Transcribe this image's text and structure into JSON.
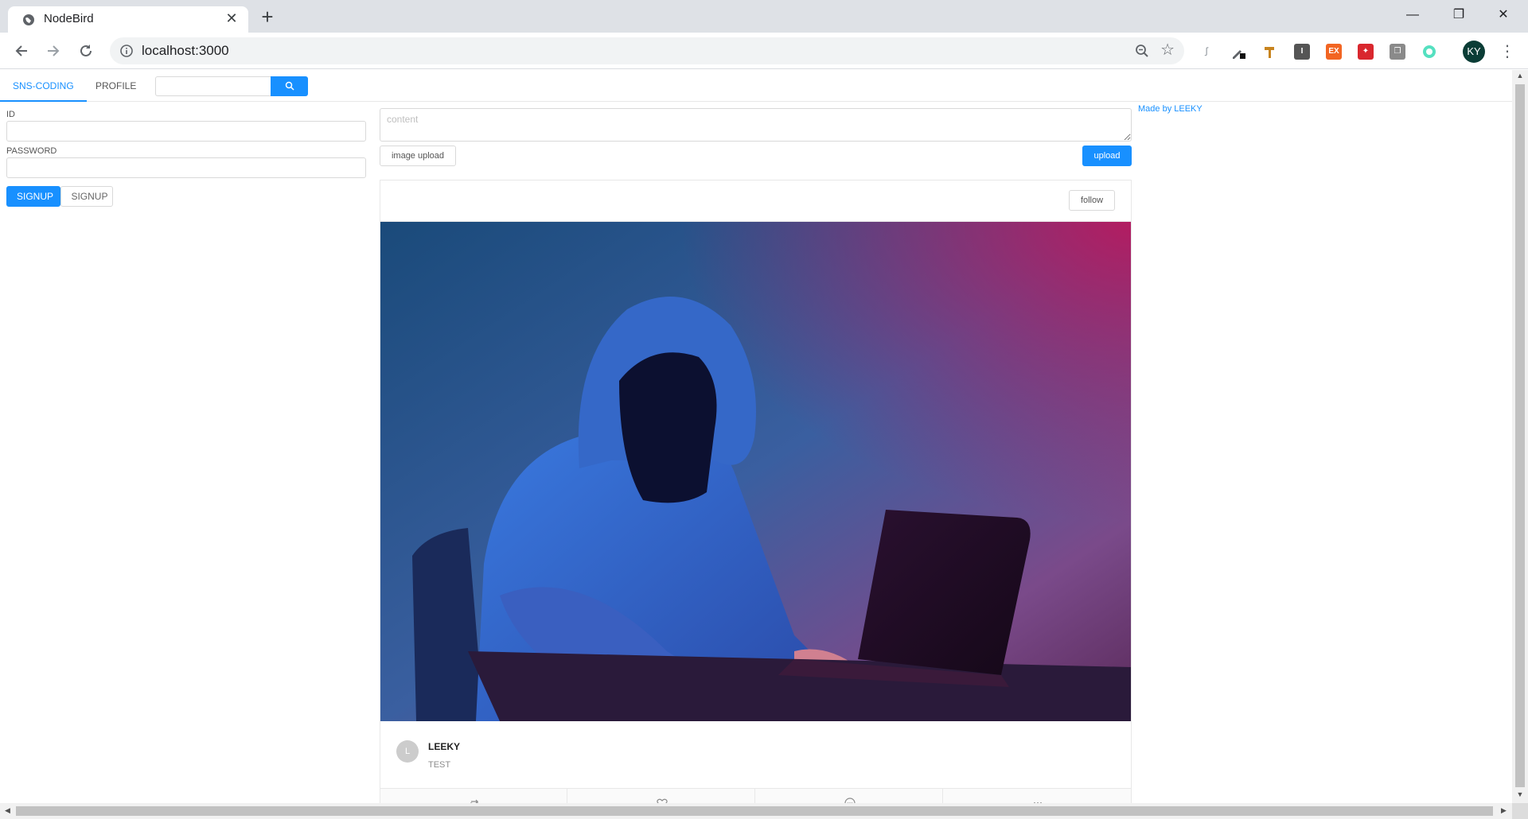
{
  "browser": {
    "tab_title": "NodeBird",
    "tab_close": "✕",
    "new_tab": "+",
    "url": "localhost:3000",
    "profile_initials": "KY",
    "window_controls": {
      "minimize": "—",
      "restore": "❐",
      "close": "✕"
    },
    "extension_ex_label": "EX"
  },
  "nav": {
    "items": [
      {
        "label": "SNS-CODING",
        "active": true
      },
      {
        "label": "PROFILE",
        "active": false
      }
    ],
    "search": {
      "value": "",
      "placeholder": ""
    }
  },
  "login": {
    "id_label": "ID",
    "id_value": "",
    "password_label": "PASSWORD",
    "password_value": "",
    "primary_button": "SIGNUP",
    "secondary_button": "SIGNUP"
  },
  "post_form": {
    "content_placeholder": "content",
    "image_upload_label": "image upload",
    "upload_label": "upload"
  },
  "sidebar": {
    "credit": "Made by LEEKY"
  },
  "post": {
    "follow_label": "follow",
    "author_initial": "L",
    "author": "LEEKY",
    "content": "TEST",
    "actions": [
      "retweet-icon",
      "heart-icon",
      "message-icon",
      "ellipsis-icon"
    ]
  },
  "colors": {
    "primary": "#1890ff",
    "chrome_bg": "#dee1e6",
    "profile_chip": "#0b3d36"
  }
}
